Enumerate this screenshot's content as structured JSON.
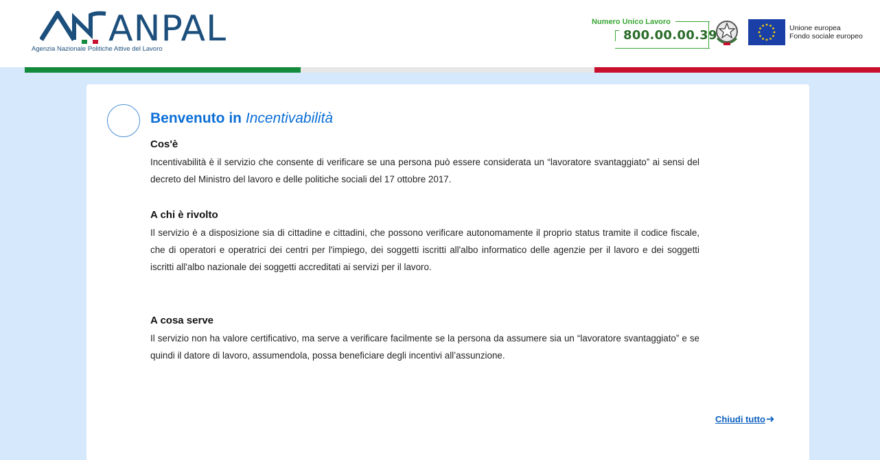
{
  "header": {
    "logo_text": "ANPAL",
    "logo_subtitle": "Agenzia Nazionale Politiche Attive del Lavoro",
    "number_label": "Numero Unico Lavoro",
    "number_value": "800.00.00.39",
    "eu_line1": "Unione europea",
    "eu_line2": "Fondo sociale europeo",
    "colors": {
      "green": "#148a3c",
      "white": "#e7e7e7",
      "red": "#c8102e",
      "brand": "#1c4f7c"
    }
  },
  "welcome": {
    "title_bold": "Benvenuto in",
    "title_italic": "Incentivabilità",
    "sections": [
      {
        "heading": "Cos'è",
        "body": "Incentivabilità è il servizio che consente di verificare se una persona può essere considerata un “lavoratore svantaggiato” ai sensi del decreto del Ministro del lavoro e delle politiche sociali del 17 ottobre 2017."
      },
      {
        "heading": "A chi è rivolto",
        "body": "Il servizio è a disposizione sia di cittadine e cittadini, che possono verificare autonomamente il proprio status tramite il codice fiscale, che di operatori e operatrici dei centri per l'impiego, dei soggetti iscritti all'albo informatico delle agenzie per il lavoro e dei soggetti iscritti all'albo nazionale dei soggetti accreditati ai servizi per il lavoro."
      },
      {
        "heading": "A cosa serve",
        "body": "Il servizio non ha valore certificativo, ma serve a verificare facilmente se la persona da assumere sia un “lavoratore svantaggiato” e se quindi il datore di lavoro, assumendola, possa beneficiare degli incentivi all’assunzione."
      }
    ],
    "close_label": "Chiudi tutto",
    "close_icon": "arrow-right-icon",
    "accent": "#0b6ed6"
  }
}
